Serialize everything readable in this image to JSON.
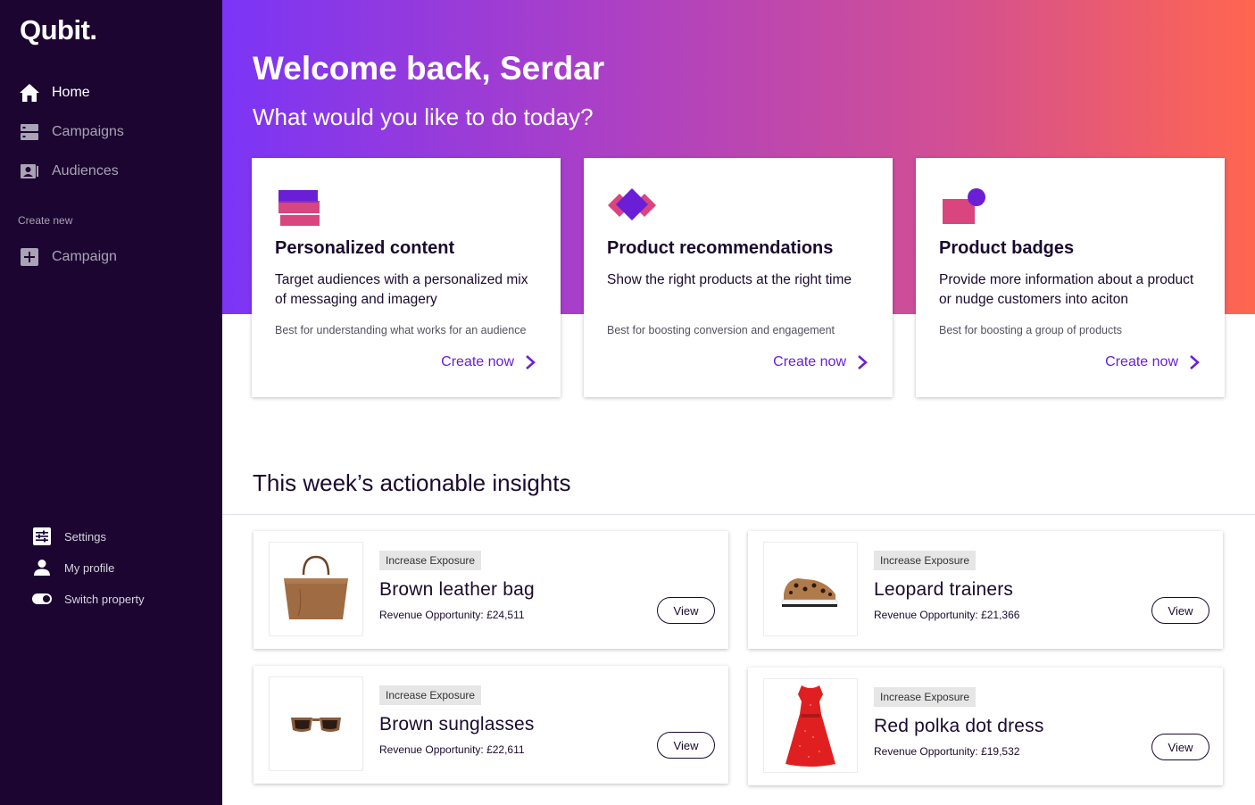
{
  "sidebar": {
    "logo": "Qubit.",
    "nav": [
      {
        "label": "Home",
        "icon": "home-icon",
        "active": true
      },
      {
        "label": "Campaigns",
        "icon": "campaigns-icon",
        "active": false
      },
      {
        "label": "Audiences",
        "icon": "audiences-icon",
        "active": false
      }
    ],
    "create_new_label": "Create new",
    "create_items": [
      {
        "label": "Campaign",
        "icon": "plus-square-icon"
      }
    ],
    "bottom": [
      {
        "label": "Settings",
        "icon": "sliders-icon"
      },
      {
        "label": "My profile",
        "icon": "user-icon"
      },
      {
        "label": "Switch property",
        "icon": "toggle-icon"
      }
    ]
  },
  "hero": {
    "title": "Welcome back, Serdar",
    "subtitle": "What would you like to do today?"
  },
  "cards": [
    {
      "title": "Personalized content",
      "description": "Target audiences with a personalized mix of messaging and imagery",
      "note": "Best for understanding what works for an audience",
      "cta": "Create now",
      "icon": "personalized-content-icon"
    },
    {
      "title": "Product recommendations",
      "description": "Show the right products at the right time",
      "note": "Best for boosting conversion and engagement",
      "cta": "Create now",
      "icon": "product-recommendations-icon"
    },
    {
      "title": "Product badges",
      "description": "Provide more information about a product or nudge customers into aciton",
      "note": "Best for boosting a group of products",
      "cta": "Create now",
      "icon": "product-badges-icon"
    }
  ],
  "insights": {
    "title": "This week’s actionable insights",
    "items": [
      {
        "tag": "Increase Exposure",
        "name": "Brown leather bag",
        "revenue": "Revenue Opportunity: £24,511",
        "action": "View",
        "image": "bag-image"
      },
      {
        "tag": "Increase Exposure",
        "name": "Leopard trainers",
        "revenue": "Revenue Opportunity: £21,366",
        "action": "View",
        "image": "trainers-image"
      },
      {
        "tag": "Increase Exposure",
        "name": "Brown sunglasses",
        "revenue": "Revenue Opportunity: £22,611",
        "action": "View",
        "image": "sunglasses-image"
      },
      {
        "tag": "Increase Exposure",
        "name": "Red polka dot dress",
        "revenue": "Revenue Opportunity: £19,532",
        "action": "View",
        "image": "dress-image"
      }
    ]
  },
  "colors": {
    "sidebar_bg": "#1c0530",
    "accent": "#6a1fd6",
    "gradient_start": "#7b35f5",
    "gradient_end": "#ff6650",
    "pink": "#d8457f"
  }
}
